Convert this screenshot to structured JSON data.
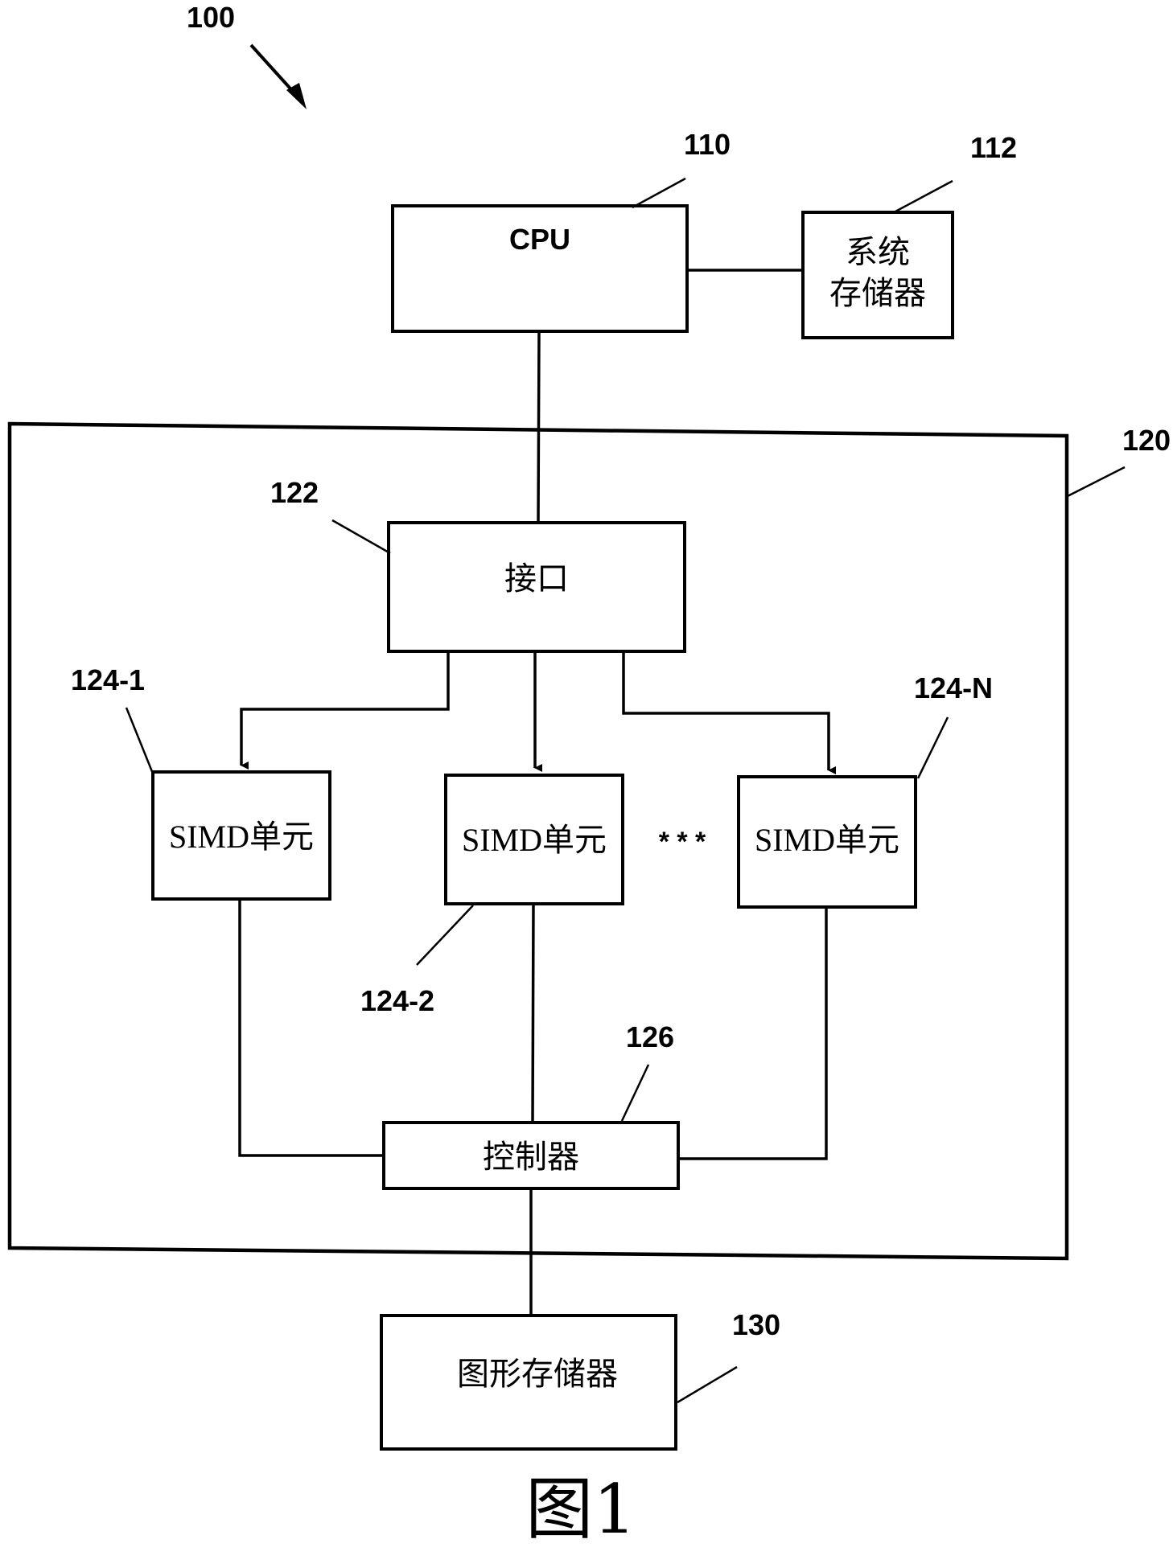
{
  "figure": {
    "caption": "图1",
    "system_ref": "100"
  },
  "cpu": {
    "ref": "110",
    "label": "CPU"
  },
  "system_memory": {
    "ref": "112",
    "line1": "系统",
    "line2": "存储器"
  },
  "gpu": {
    "ref": "120"
  },
  "interface": {
    "ref": "122",
    "label": "接口"
  },
  "simd_units": [
    {
      "ref": "124-1",
      "label": "SIMD单元"
    },
    {
      "ref": "124-2",
      "label": "SIMD单元"
    },
    {
      "ref": "124-N",
      "label": "SIMD单元"
    }
  ],
  "ellipsis": "* * *",
  "controller": {
    "ref": "126",
    "label": "控制器"
  },
  "graphics_memory": {
    "ref": "130",
    "label": "图形存储器"
  }
}
